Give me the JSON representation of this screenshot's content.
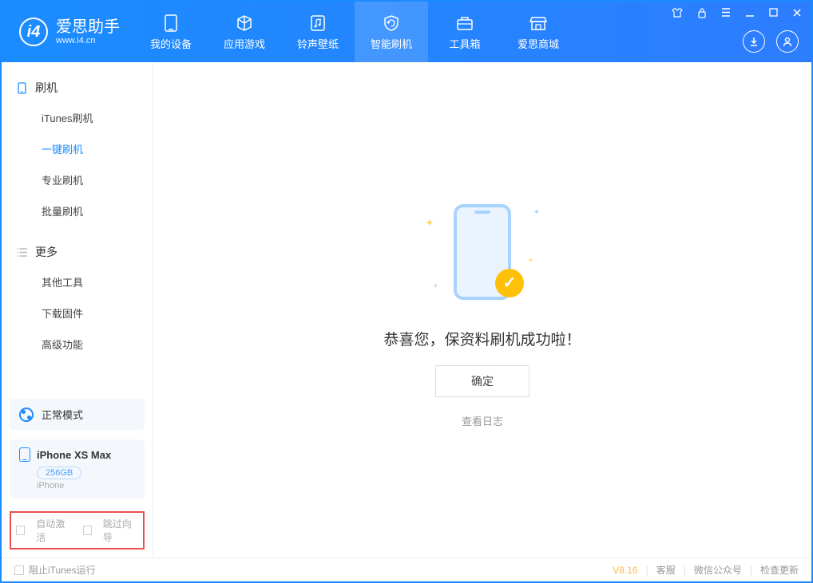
{
  "app": {
    "name_cn": "爱思助手",
    "name_en": "www.i4.cn"
  },
  "nav": {
    "items": [
      {
        "label": "我的设备"
      },
      {
        "label": "应用游戏"
      },
      {
        "label": "铃声壁纸"
      },
      {
        "label": "智能刷机"
      },
      {
        "label": "工具箱"
      },
      {
        "label": "爱思商城"
      }
    ]
  },
  "sidebar": {
    "sections": [
      {
        "title": "刷机",
        "items": [
          {
            "label": "iTunes刷机"
          },
          {
            "label": "一键刷机"
          },
          {
            "label": "专业刷机"
          },
          {
            "label": "批量刷机"
          }
        ]
      },
      {
        "title": "更多",
        "items": [
          {
            "label": "其他工具"
          },
          {
            "label": "下载固件"
          },
          {
            "label": "高级功能"
          }
        ]
      }
    ],
    "mode": "正常模式",
    "device": {
      "name": "iPhone XS Max",
      "storage": "256GB",
      "type": "iPhone"
    },
    "checkboxes": {
      "auto_activate": "自动激活",
      "skip_guide": "跳过向导"
    }
  },
  "main": {
    "success_text": "恭喜您，保资料刷机成功啦！",
    "confirm_label": "确定",
    "view_log": "查看日志"
  },
  "footer": {
    "block_itunes": "阻止iTunes运行",
    "version": "V8.16",
    "links": {
      "service": "客服",
      "wechat": "微信公众号",
      "update": "检查更新"
    }
  }
}
